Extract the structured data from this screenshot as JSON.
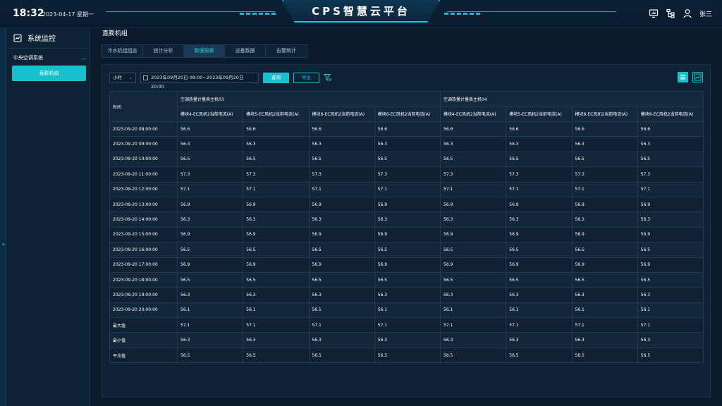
{
  "header": {
    "time": "18:32",
    "date": "2023-04-17 星期一",
    "title": "CPS智慧云平台",
    "user": "张三"
  },
  "sidebar": {
    "title": "系统监控",
    "group": "中央空调系统",
    "items": [
      {
        "label": "直膨机组"
      }
    ]
  },
  "main": {
    "page_title": "直膨机组",
    "tabs": [
      {
        "label": "冷水机组组态"
      },
      {
        "label": "统计分析"
      },
      {
        "label": "数据报表"
      },
      {
        "label": "设备数据"
      },
      {
        "label": "告警统计"
      }
    ],
    "active_tab_index": 2,
    "toolbar": {
      "interval": "小时",
      "date_range": "2023年09月20日 08:00~2023年09月20日 20:00",
      "query_label": "查询",
      "export_label": "导出"
    },
    "table": {
      "time_header": "时间",
      "groups": [
        "空调热量计量表主机03",
        "空调热量计量表主机04"
      ],
      "columns": [
        "模块4-EC风机2当前电流(A)",
        "模块5-EC风机2当前电流(A)",
        "模块6-EC风机2当前电流(A)",
        "模块6-EC风机2当前电流(A)",
        "模块4-EC风机2当前电流(A)",
        "模块5-EC风机2当前电流(A)",
        "模块6-EC风机2当前电流(A)",
        "模块6-EC风机2当前电流(A)"
      ],
      "rows": [
        {
          "time": "2023-09-20 08:00:00",
          "value": "56.6"
        },
        {
          "time": "2023-09-20 09:00:00",
          "value": "56.3"
        },
        {
          "time": "2023-09-20 10:00:00",
          "value": "56.5"
        },
        {
          "time": "2023-09-20 11:00:00",
          "value": "57.3"
        },
        {
          "time": "2023-09-20 12:00:00",
          "value": "57.1"
        },
        {
          "time": "2023-09-20 13:00:00",
          "value": "56.9"
        },
        {
          "time": "2023-09-20 14:00:00",
          "value": "56.3"
        },
        {
          "time": "2023-09-20 15:00:00",
          "value": "56.9"
        },
        {
          "time": "2023-09-20 16:00:00",
          "value": "56.5"
        },
        {
          "time": "2023-09-20 17:00:00",
          "value": "56.9"
        },
        {
          "time": "2023-09-20 18:00:00",
          "value": "56.5"
        },
        {
          "time": "2023-09-20 19:00:00",
          "value": "56.3"
        },
        {
          "time": "2023-09-20 20:00:00",
          "value": "56.1"
        },
        {
          "time": "最大值",
          "value": "57.1"
        },
        {
          "time": "最小值",
          "value": "56.3"
        },
        {
          "time": "平均值",
          "value": "56.5"
        }
      ]
    }
  },
  "colors": {
    "accent": "#18bfcc",
    "background": "#0a1a2c",
    "panel": "#0f2236"
  },
  "icons": {
    "header": [
      "monitor-icon",
      "org-chart-icon",
      "user-icon"
    ],
    "sidebar": "dashboard-icon",
    "toolbar": [
      "calendar-icon",
      "chevron-down-icon",
      "filter-icon"
    ],
    "view": [
      "list-view-icon",
      "chart-view-icon"
    ]
  }
}
